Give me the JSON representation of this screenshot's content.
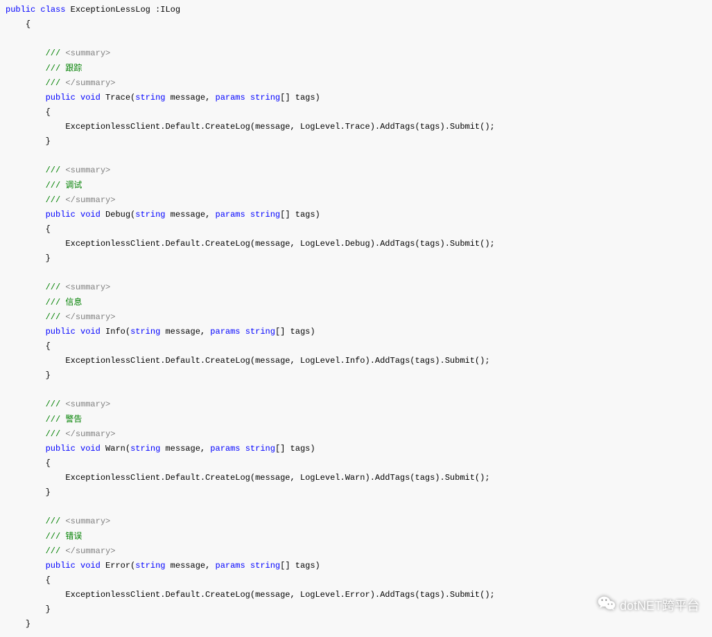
{
  "code": {
    "decl_public": "public",
    "decl_class": "class",
    "class_name": "ExceptionLessLog :ILog",
    "brace_open": "{",
    "brace_close": "}",
    "comment_slashes": "///",
    "summary_open": "<summary>",
    "summary_close": "</summary>",
    "kw_void": "void",
    "kw_params": "params",
    "type_string": "string",
    "type_string_arr": "string",
    "sig_suffix_open": "(",
    "sig_param1": " message, ",
    "sig_param2": "[] tags)",
    "body_prefix": "ExceptionlessClient.Default.CreateLog(message, LogLevel.",
    "body_suffix": ").AddTags(tags).Submit();",
    "methods": [
      {
        "zh": "跟踪",
        "name": "Trace",
        "level": "Trace"
      },
      {
        "zh": "调试",
        "name": "Debug",
        "level": "Debug"
      },
      {
        "zh": "信息",
        "name": "Info",
        "level": "Info"
      },
      {
        "zh": "警告",
        "name": "Warn",
        "level": "Warn"
      },
      {
        "zh": "错误",
        "name": "Error",
        "level": "Error"
      }
    ]
  },
  "watermark": {
    "text": "dotNET跨平台"
  }
}
